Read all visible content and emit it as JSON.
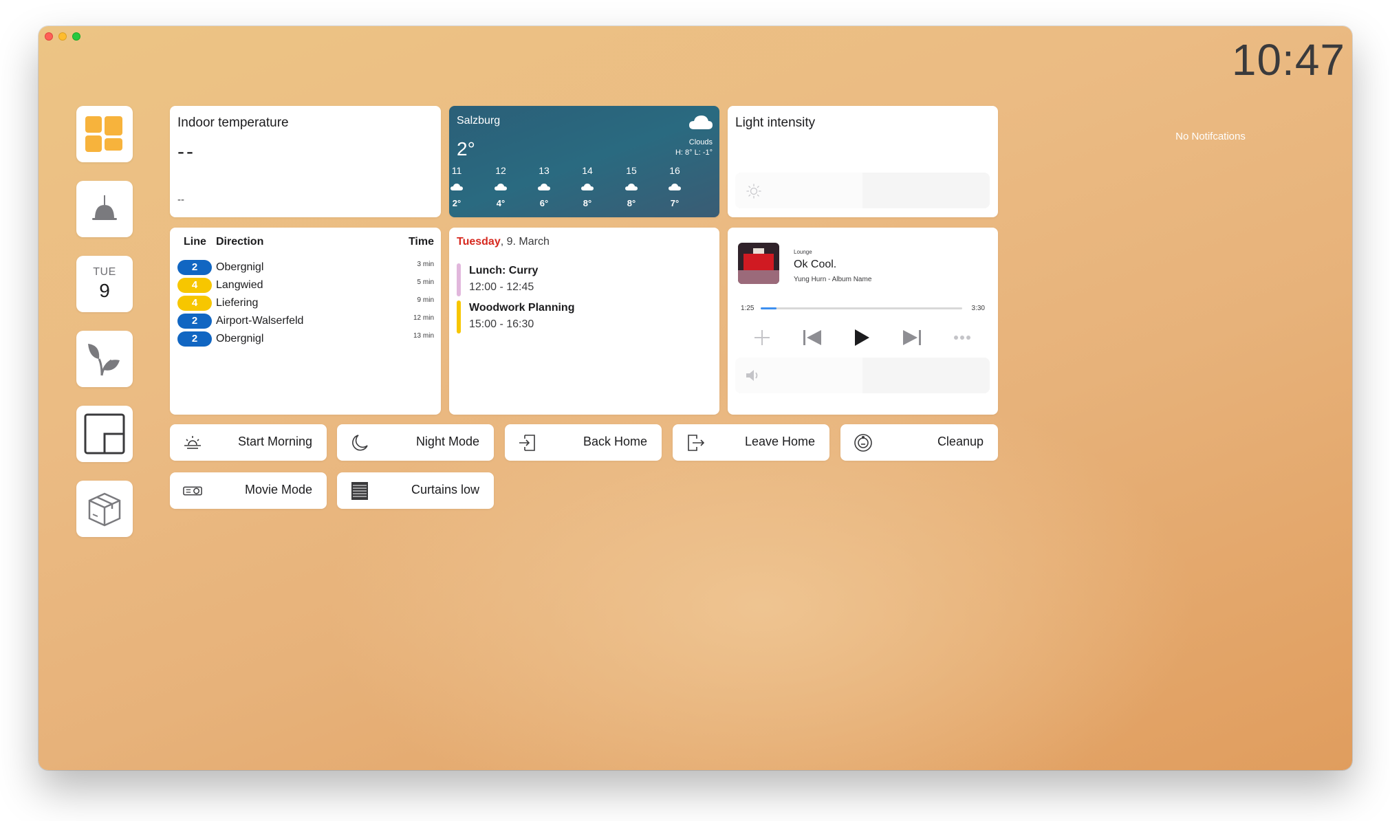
{
  "clock": "10:47",
  "notifications": "No Notifcations",
  "sidebar": {
    "items": [
      {
        "icon": "dashboard-icon"
      },
      {
        "icon": "ceiling-lamp-icon"
      },
      {
        "icon": "calendar-icon",
        "day": "TUE",
        "date": "9"
      },
      {
        "icon": "plant-icon"
      },
      {
        "icon": "floorplan-icon"
      },
      {
        "icon": "package-icon"
      }
    ]
  },
  "indoor": {
    "title": "Indoor temperature",
    "value": "--",
    "sub": "--"
  },
  "weather": {
    "city": "Salzburg",
    "temp": "2°",
    "condition": "Clouds",
    "hl": "H: 8° L: -1°",
    "icon": "cloud-icon",
    "hours": [
      {
        "h": "11",
        "t": "2°"
      },
      {
        "h": "12",
        "t": "4°"
      },
      {
        "h": "13",
        "t": "6°"
      },
      {
        "h": "14",
        "t": "8°"
      },
      {
        "h": "15",
        "t": "8°"
      },
      {
        "h": "16",
        "t": "7°"
      }
    ],
    "gradient": [
      "#2b5f78",
      "#3a5c74"
    ]
  },
  "light": {
    "title": "Light intensity",
    "level": 0.5
  },
  "transit": {
    "headers": {
      "line": "Line",
      "direction": "Direction",
      "time": "Time"
    },
    "rows": [
      {
        "line": "2",
        "direction": "Obergnigl",
        "time": "3 min",
        "color": "#1166c2"
      },
      {
        "line": "4",
        "direction": "Langwied",
        "time": "5 min",
        "color": "#f7c600"
      },
      {
        "line": "4",
        "direction": "Liefering",
        "time": "9 min",
        "color": "#f7c600"
      },
      {
        "line": "2",
        "direction": "Airport-Walserfeld",
        "time": "12 min",
        "color": "#1166c2"
      },
      {
        "line": "2",
        "direction": "Obergnigl",
        "time": "13 min",
        "color": "#1166c2"
      }
    ]
  },
  "calendar": {
    "weekday": "Tuesday",
    "date": ", 9. March",
    "events": [
      {
        "title": "Lunch: Curry",
        "time": "12:00 - 12:45",
        "color": "#e1b7dc"
      },
      {
        "title": "Woodwork Planning",
        "time": "15:00 - 16:30",
        "color": "#f7c600"
      }
    ]
  },
  "music": {
    "room": "Lounge",
    "title": "Ok Cool.",
    "subtitle": "Yung Hurn - Album Name",
    "current": "1:25",
    "total": "3:30",
    "progress": 0.08,
    "volume": 0.5,
    "accent": "#3d8fef"
  },
  "scenes": [
    {
      "label": "Start Morning",
      "icon": "sunrise-icon"
    },
    {
      "label": "Night Mode",
      "icon": "moon-icon"
    },
    {
      "label": "Back Home",
      "icon": "door-enter-icon"
    },
    {
      "label": "Leave Home",
      "icon": "door-exit-icon"
    },
    {
      "label": "Cleanup",
      "icon": "robot-vacuum-icon"
    },
    {
      "label": "Movie Mode",
      "icon": "projector-icon"
    },
    {
      "label": "Curtains low",
      "icon": "blinds-icon"
    }
  ]
}
